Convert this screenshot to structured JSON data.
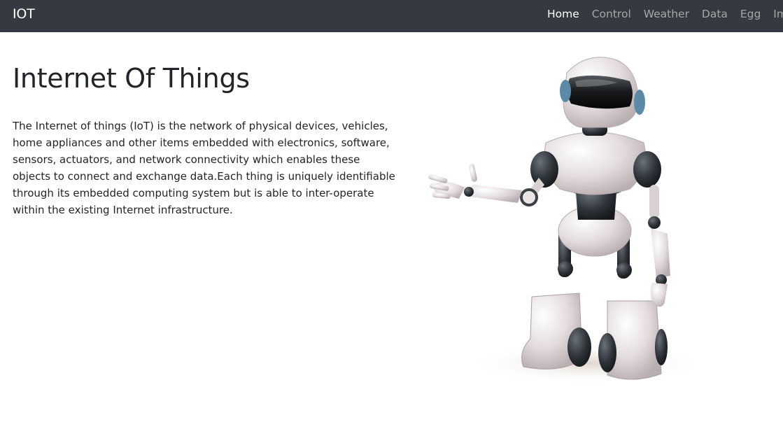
{
  "navbar": {
    "brand": "IOT",
    "items": [
      {
        "label": "Home",
        "active": true
      },
      {
        "label": "Control",
        "active": false
      },
      {
        "label": "Weather",
        "active": false
      },
      {
        "label": "Data",
        "active": false
      },
      {
        "label": "Egg",
        "active": false
      },
      {
        "label": "Images",
        "active": false
      }
    ]
  },
  "main": {
    "title": "Internet Of Things",
    "paragraph": "The Internet of things (IoT) is the network of physical devices, vehicles, home appliances and other items embedded with electronics, software, sensors, actuators, and network connectivity which enables these objects to connect and exchange data.Each thing is uniquely identifiable through its embedded computing system but is able to inter-operate within the existing Internet infrastructure."
  },
  "colors": {
    "navbar_bg": "#343a40",
    "nav_active": "#ffffff",
    "nav_inactive": "rgba(255,255,255,0.55)",
    "text": "#212529"
  },
  "image": {
    "icon": "robot-illustration"
  }
}
